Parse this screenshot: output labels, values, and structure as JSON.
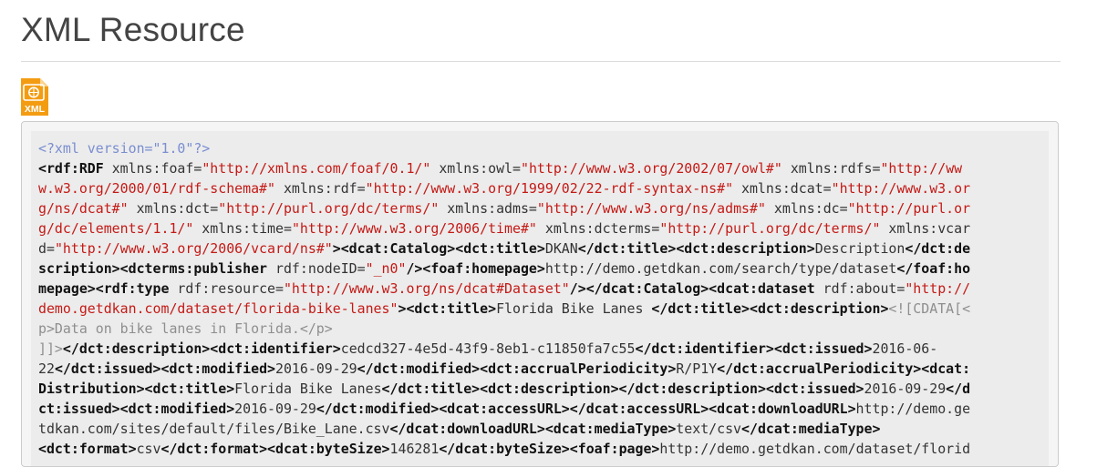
{
  "page": {
    "title": "XML Resource"
  },
  "icon": {
    "name": "xml-file-icon",
    "label": "XML",
    "color": "#f39c12"
  },
  "colors": {
    "tag": "#111111",
    "attribute_value": "#c41a16",
    "processing_instruction": "#7a8ed0",
    "cdata": "#8e8e8e",
    "text": "#333333"
  },
  "code_lines": [
    [
      {
        "t": "pi",
        "s": "<?xml version=\"1.0\"?>"
      }
    ],
    [
      {
        "t": "tag",
        "s": "<rdf:RDF"
      },
      {
        "t": "txt",
        "s": " xmlns:foaf="
      },
      {
        "t": "val",
        "s": "\"http://xmlns.com/foaf/0.1/\""
      },
      {
        "t": "txt",
        "s": " xmlns:owl="
      },
      {
        "t": "val",
        "s": "\"http://www.w3.org/2002/07/owl#\""
      },
      {
        "t": "txt",
        "s": " xmlns:rdfs="
      },
      {
        "t": "val",
        "s": "\"http://ww"
      }
    ],
    [
      {
        "t": "val",
        "s": "w.w3.org/2000/01/rdf-schema#\""
      },
      {
        "t": "txt",
        "s": " xmlns:rdf="
      },
      {
        "t": "val",
        "s": "\"http://www.w3.org/1999/02/22-rdf-syntax-ns#\""
      },
      {
        "t": "txt",
        "s": " xmlns:dcat="
      },
      {
        "t": "val",
        "s": "\"http://www.w3.or"
      }
    ],
    [
      {
        "t": "val",
        "s": "g/ns/dcat#\""
      },
      {
        "t": "txt",
        "s": " xmlns:dct="
      },
      {
        "t": "val",
        "s": "\"http://purl.org/dc/terms/\""
      },
      {
        "t": "txt",
        "s": " xmlns:adms="
      },
      {
        "t": "val",
        "s": "\"http://www.w3.org/ns/adms#\""
      },
      {
        "t": "txt",
        "s": " xmlns:dc="
      },
      {
        "t": "val",
        "s": "\"http://purl.or"
      }
    ],
    [
      {
        "t": "val",
        "s": "g/dc/elements/1.1/\""
      },
      {
        "t": "txt",
        "s": " xmlns:time="
      },
      {
        "t": "val",
        "s": "\"http://www.w3.org/2006/time#\""
      },
      {
        "t": "txt",
        "s": " xmlns:dcterms="
      },
      {
        "t": "val",
        "s": "\"http://purl.org/dc/terms/\""
      },
      {
        "t": "txt",
        "s": " xmlns:vcar"
      }
    ],
    [
      {
        "t": "txt",
        "s": "d="
      },
      {
        "t": "val",
        "s": "\"http://www.w3.org/2006/vcard/ns#\""
      },
      {
        "t": "tag",
        "s": ">"
      },
      {
        "t": "tag",
        "s": "<dcat:Catalog>"
      },
      {
        "t": "tag",
        "s": "<dct:title>"
      },
      {
        "t": "txt",
        "s": "DKAN"
      },
      {
        "t": "tag",
        "s": "</dct:title>"
      },
      {
        "t": "tag",
        "s": "<dct:description>"
      },
      {
        "t": "txt",
        "s": "Description"
      },
      {
        "t": "tag",
        "s": "</dct:de"
      }
    ],
    [
      {
        "t": "tag",
        "s": "scription>"
      },
      {
        "t": "tag",
        "s": "<dcterms:publisher"
      },
      {
        "t": "txt",
        "s": " rdf:nodeID="
      },
      {
        "t": "val",
        "s": "\"_n0\""
      },
      {
        "t": "tag",
        "s": "/>"
      },
      {
        "t": "tag",
        "s": "<foaf:homepage>"
      },
      {
        "t": "txt",
        "s": "http://demo.getdkan.com/search/type/dataset"
      },
      {
        "t": "tag",
        "s": "</foaf:ho"
      }
    ],
    [
      {
        "t": "tag",
        "s": "mepage>"
      },
      {
        "t": "tag",
        "s": "<rdf:type"
      },
      {
        "t": "txt",
        "s": " rdf:resource="
      },
      {
        "t": "val",
        "s": "\"http://www.w3.org/ns/dcat#Dataset\""
      },
      {
        "t": "tag",
        "s": "/>"
      },
      {
        "t": "tag",
        "s": "</dcat:Catalog>"
      },
      {
        "t": "tag",
        "s": "<dcat:dataset"
      },
      {
        "t": "txt",
        "s": " rdf:about="
      },
      {
        "t": "val",
        "s": "\"http://"
      }
    ],
    [
      {
        "t": "val",
        "s": "demo.getdkan.com/dataset/florida-bike-lanes\""
      },
      {
        "t": "tag",
        "s": ">"
      },
      {
        "t": "tag",
        "s": "<dct:title>"
      },
      {
        "t": "txt",
        "s": "Florida Bike Lanes "
      },
      {
        "t": "tag",
        "s": "</dct:title>"
      },
      {
        "t": "tag",
        "s": "<dct:description>"
      },
      {
        "t": "cdata",
        "s": "<![CDATA[<"
      }
    ],
    [
      {
        "t": "cdata",
        "s": "p>Data on bike lanes in Florida.</p>"
      }
    ],
    [
      {
        "t": "cdata",
        "s": "]]>"
      },
      {
        "t": "tag",
        "s": "</dct:description>"
      },
      {
        "t": "tag",
        "s": "<dct:identifier>"
      },
      {
        "t": "txt",
        "s": "cedcd327-4e5d-43f9-8eb1-c11850fa7c55"
      },
      {
        "t": "tag",
        "s": "</dct:identifier>"
      },
      {
        "t": "tag",
        "s": "<dct:issued>"
      },
      {
        "t": "txt",
        "s": "2016-06-"
      }
    ],
    [
      {
        "t": "txt",
        "s": "22"
      },
      {
        "t": "tag",
        "s": "</dct:issued>"
      },
      {
        "t": "tag",
        "s": "<dct:modified>"
      },
      {
        "t": "txt",
        "s": "2016-09-29"
      },
      {
        "t": "tag",
        "s": "</dct:modified>"
      },
      {
        "t": "tag",
        "s": "<dct:accrualPeriodicity>"
      },
      {
        "t": "txt",
        "s": "R/P1Y"
      },
      {
        "t": "tag",
        "s": "</dct:accrualPeriodicity>"
      },
      {
        "t": "tag",
        "s": "<dcat:"
      }
    ],
    [
      {
        "t": "tag",
        "s": "Distribution>"
      },
      {
        "t": "tag",
        "s": "<dct:title>"
      },
      {
        "t": "txt",
        "s": "Florida Bike Lanes"
      },
      {
        "t": "tag",
        "s": "</dct:title>"
      },
      {
        "t": "tag",
        "s": "<dct:description>"
      },
      {
        "t": "tag",
        "s": "</dct:description>"
      },
      {
        "t": "tag",
        "s": "<dct:issued>"
      },
      {
        "t": "txt",
        "s": "2016-09-29"
      },
      {
        "t": "tag",
        "s": "</d"
      }
    ],
    [
      {
        "t": "tag",
        "s": "ct:issued>"
      },
      {
        "t": "tag",
        "s": "<dct:modified>"
      },
      {
        "t": "txt",
        "s": "2016-09-29"
      },
      {
        "t": "tag",
        "s": "</dct:modified>"
      },
      {
        "t": "tag",
        "s": "<dcat:accessURL>"
      },
      {
        "t": "tag",
        "s": "</dcat:accessURL>"
      },
      {
        "t": "tag",
        "s": "<dcat:downloadURL>"
      },
      {
        "t": "txt",
        "s": "http://demo.ge"
      }
    ],
    [
      {
        "t": "txt",
        "s": "tdkan.com/sites/default/files/Bike_Lane.csv"
      },
      {
        "t": "tag",
        "s": "</dcat:downloadURL>"
      },
      {
        "t": "tag",
        "s": "<dcat:mediaType>"
      },
      {
        "t": "txt",
        "s": "text/csv"
      },
      {
        "t": "tag",
        "s": "</dcat:mediaType>"
      }
    ],
    [
      {
        "t": "tag",
        "s": "<dct:format>"
      },
      {
        "t": "txt",
        "s": "csv"
      },
      {
        "t": "tag",
        "s": "</dct:format>"
      },
      {
        "t": "tag",
        "s": "<dcat:byteSize>"
      },
      {
        "t": "txt",
        "s": "146281"
      },
      {
        "t": "tag",
        "s": "</dcat:byteSize>"
      },
      {
        "t": "tag",
        "s": "<foaf:page>"
      },
      {
        "t": "txt",
        "s": "http://demo.getdkan.com/dataset/florid"
      }
    ]
  ]
}
